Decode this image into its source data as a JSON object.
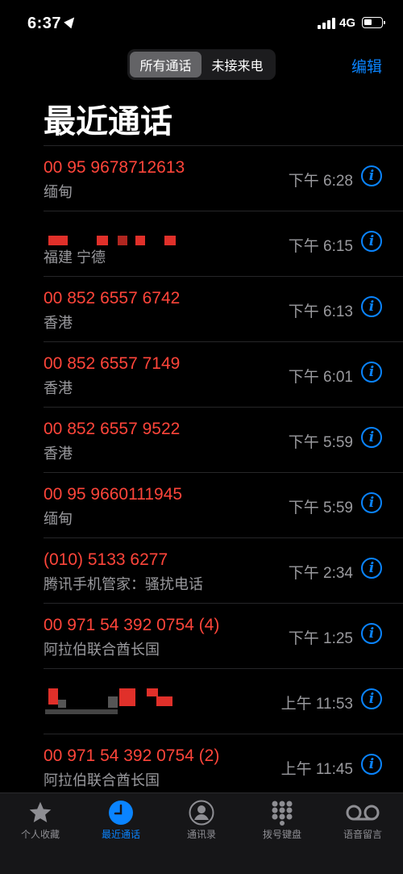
{
  "status": {
    "time": "6:37",
    "network": "4G"
  },
  "segment": {
    "all": "所有通话",
    "missed": "未接来电"
  },
  "edit_label": "编辑",
  "title": "最近通话",
  "calls": [
    {
      "name": "00 95 9678712613",
      "sub": "缅甸",
      "time": "下午 6:28"
    },
    {
      "name": "",
      "sub": "福建 宁德",
      "time": "下午 6:15"
    },
    {
      "name": "00 852 6557 6742",
      "sub": "香港",
      "time": "下午 6:13"
    },
    {
      "name": "00 852 6557 7149",
      "sub": "香港",
      "time": "下午 6:01"
    },
    {
      "name": "00 852 6557 9522",
      "sub": "香港",
      "time": "下午 5:59"
    },
    {
      "name": "00 95 9660111945",
      "sub": "缅甸",
      "time": "下午 5:59"
    },
    {
      "name": "(010) 5133 6277",
      "sub": "腾讯手机管家：骚扰电话",
      "time": "下午 2:34"
    },
    {
      "name": "00 971 54 392 0754 (4)",
      "sub": "阿拉伯联合酋长国",
      "time": "下午 1:25"
    },
    {
      "name": "",
      "sub": "",
      "time": "上午 11:53"
    },
    {
      "name": "00 971 54 392 0754 (2)",
      "sub": "阿拉伯联合酋长国",
      "time": "上午 11:45"
    }
  ],
  "tabs": [
    {
      "label": "个人收藏",
      "icon": "star-icon"
    },
    {
      "label": "最近通话",
      "icon": "clock-icon"
    },
    {
      "label": "通讯录",
      "icon": "person-icon"
    },
    {
      "label": "拨号键盘",
      "icon": "keypad-icon"
    },
    {
      "label": "语音留言",
      "icon": "voicemail-icon"
    }
  ],
  "colors": {
    "missed_red": "#ff453a",
    "accent_blue": "#0a84ff",
    "secondary_text": "#9a9a9e"
  }
}
